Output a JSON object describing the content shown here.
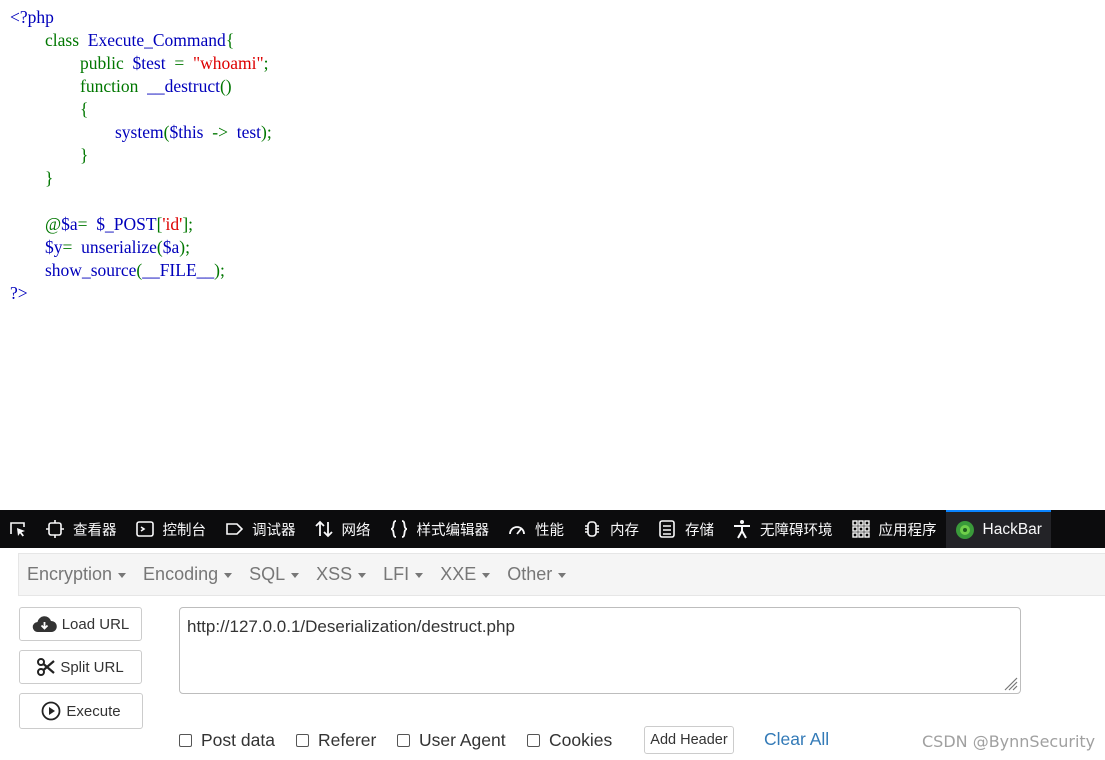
{
  "code_lines": [
    [
      {
        "t": "<?php",
        "c": "blue"
      }
    ],
    [
      {
        "t": "        class  ",
        "c": "green"
      },
      {
        "t": "Execute_Command",
        "c": "blue"
      },
      {
        "t": "{",
        "c": "green"
      }
    ],
    [
      {
        "t": "                public  ",
        "c": "green"
      },
      {
        "t": "$test  ",
        "c": "blue"
      },
      {
        "t": "=  ",
        "c": "green"
      },
      {
        "t": "\"whoami\"",
        "c": "red"
      },
      {
        "t": ";",
        "c": "green"
      }
    ],
    [
      {
        "t": "                function  ",
        "c": "green"
      },
      {
        "t": "__destruct",
        "c": "blue"
      },
      {
        "t": "()",
        "c": "green"
      }
    ],
    [
      {
        "t": "                {",
        "c": "green"
      }
    ],
    [
      {
        "t": "                        ",
        "c": "green"
      },
      {
        "t": "system",
        "c": "blue"
      },
      {
        "t": "(",
        "c": "green"
      },
      {
        "t": "$this  ",
        "c": "blue"
      },
      {
        "t": "->  ",
        "c": "green"
      },
      {
        "t": "test",
        "c": "blue"
      },
      {
        "t": ");",
        "c": "green"
      }
    ],
    [
      {
        "t": "                }",
        "c": "green"
      }
    ],
    [
      {
        "t": "        }",
        "c": "green"
      }
    ],
    [
      {
        "t": "",
        "c": "green"
      }
    ],
    [
      {
        "t": "        @",
        "c": "green"
      },
      {
        "t": "$a",
        "c": "blue"
      },
      {
        "t": "=  ",
        "c": "green"
      },
      {
        "t": "$_POST",
        "c": "blue"
      },
      {
        "t": "[",
        "c": "green"
      },
      {
        "t": "'id'",
        "c": "red"
      },
      {
        "t": "];",
        "c": "green"
      }
    ],
    [
      {
        "t": "        ",
        "c": "green"
      },
      {
        "t": "$y",
        "c": "blue"
      },
      {
        "t": "=  ",
        "c": "green"
      },
      {
        "t": "unserialize",
        "c": "blue"
      },
      {
        "t": "(",
        "c": "green"
      },
      {
        "t": "$a",
        "c": "blue"
      },
      {
        "t": ");",
        "c": "green"
      }
    ],
    [
      {
        "t": "        ",
        "c": "green"
      },
      {
        "t": "show_source",
        "c": "blue"
      },
      {
        "t": "(",
        "c": "green"
      },
      {
        "t": "__FILE__",
        "c": "blue"
      },
      {
        "t": ");",
        "c": "green"
      }
    ],
    [
      {
        "t": "?>",
        "c": "blue"
      }
    ]
  ],
  "devtools": {
    "tabs": [
      {
        "label": "查看器",
        "icon": "inspector-icon"
      },
      {
        "label": "控制台",
        "icon": "console-icon"
      },
      {
        "label": "调试器",
        "icon": "debugger-icon"
      },
      {
        "label": "网络",
        "icon": "network-icon"
      },
      {
        "label": "样式编辑器",
        "icon": "style-editor-icon"
      },
      {
        "label": "性能",
        "icon": "performance-icon"
      },
      {
        "label": "内存",
        "icon": "memory-icon"
      },
      {
        "label": "存储",
        "icon": "storage-icon"
      },
      {
        "label": "无障碍环境",
        "icon": "accessibility-icon"
      },
      {
        "label": "应用程序",
        "icon": "application-icon"
      }
    ],
    "active_tab": "HackBar"
  },
  "hackbar": {
    "menus": [
      "Encryption",
      "Encoding",
      "SQL",
      "XSS",
      "LFI",
      "XXE",
      "Other"
    ],
    "load_url": "Load URL",
    "split_url": "Split URL",
    "execute": "Execute",
    "url": "http://127.0.0.1/Deserialization/destruct.php",
    "options": {
      "post_data": "Post data",
      "referer": "Referer",
      "user_agent": "User Agent",
      "cookies": "Cookies"
    },
    "add_header": "Add Header",
    "clear_all": "Clear All"
  },
  "watermark": "CSDN @BynnSecurity",
  "colors": {
    "php_blue": "#0000BB",
    "php_green": "#007700",
    "php_red": "#DD0000",
    "devtools_bg": "#0c0c0d",
    "link_blue": "#337ab7"
  }
}
